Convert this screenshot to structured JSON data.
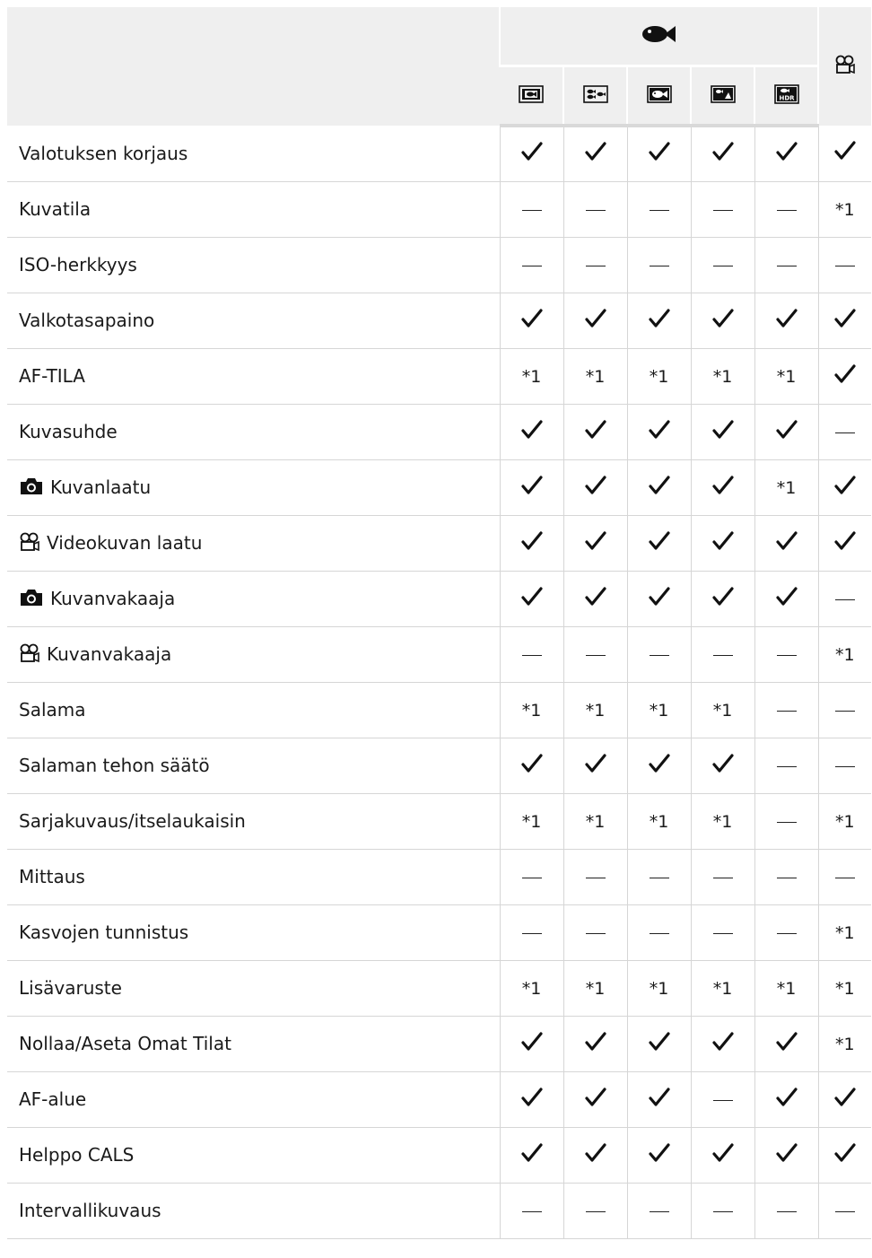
{
  "header": {
    "group_icon": "fish-icon",
    "movie_icon": "movie-camera-icon",
    "mode_icons": [
      "underwater-snapshot-icon",
      "underwater-wide-icon",
      "underwater-macro-icon",
      "underwater-microscope-icon",
      "underwater-hdr-icon"
    ],
    "hdr_text": "HDR"
  },
  "rows": [
    {
      "label": "Valotuksen korjaus",
      "icon": null,
      "values": [
        "check",
        "check",
        "check",
        "check",
        "check",
        "check"
      ]
    },
    {
      "label": "Kuvatila",
      "icon": null,
      "values": [
        "dash",
        "dash",
        "dash",
        "dash",
        "dash",
        "*1"
      ]
    },
    {
      "label": "ISO-herkkyys",
      "icon": null,
      "values": [
        "dash",
        "dash",
        "dash",
        "dash",
        "dash",
        "dash"
      ]
    },
    {
      "label": "Valkotasapaino",
      "icon": null,
      "values": [
        "check",
        "check",
        "check",
        "check",
        "check",
        "check"
      ]
    },
    {
      "label": "AF-TILA",
      "icon": null,
      "values": [
        "*1",
        "*1",
        "*1",
        "*1",
        "*1",
        "check"
      ]
    },
    {
      "label": "Kuvasuhde",
      "icon": null,
      "values": [
        "check",
        "check",
        "check",
        "check",
        "check",
        "dash"
      ]
    },
    {
      "label": "Kuvanlaatu",
      "icon": "still-camera-icon",
      "values": [
        "check",
        "check",
        "check",
        "check",
        "*1",
        "check"
      ]
    },
    {
      "label": "Videokuvan laatu",
      "icon": "movie-camera-icon",
      "values": [
        "check",
        "check",
        "check",
        "check",
        "check",
        "check"
      ]
    },
    {
      "label": "Kuvanvakaaja",
      "icon": "still-camera-icon",
      "values": [
        "check",
        "check",
        "check",
        "check",
        "check",
        "dash"
      ]
    },
    {
      "label": "Kuvanvakaaja",
      "icon": "movie-camera-icon",
      "values": [
        "dash",
        "dash",
        "dash",
        "dash",
        "dash",
        "*1"
      ]
    },
    {
      "label": "Salama",
      "icon": null,
      "values": [
        "*1",
        "*1",
        "*1",
        "*1",
        "dash",
        "dash"
      ]
    },
    {
      "label": "Salaman tehon säätö",
      "icon": null,
      "values": [
        "check",
        "check",
        "check",
        "check",
        "dash",
        "dash"
      ]
    },
    {
      "label": "Sarjakuvaus/itselaukaisin",
      "icon": null,
      "values": [
        "*1",
        "*1",
        "*1",
        "*1",
        "dash",
        "*1"
      ]
    },
    {
      "label": "Mittaus",
      "icon": null,
      "values": [
        "dash",
        "dash",
        "dash",
        "dash",
        "dash",
        "dash"
      ]
    },
    {
      "label": "Kasvojen tunnistus",
      "icon": null,
      "values": [
        "dash",
        "dash",
        "dash",
        "dash",
        "dash",
        "*1"
      ]
    },
    {
      "label": "Lisävaruste",
      "icon": null,
      "values": [
        "*1",
        "*1",
        "*1",
        "*1",
        "*1",
        "*1"
      ]
    },
    {
      "label": "Nollaa/Aseta Omat Tilat",
      "icon": null,
      "values": [
        "check",
        "check",
        "check",
        "check",
        "check",
        "*1"
      ]
    },
    {
      "label": "AF-alue",
      "icon": null,
      "values": [
        "check",
        "check",
        "check",
        "dash",
        "check",
        "check"
      ]
    },
    {
      "label": "Helppo CALS",
      "icon": null,
      "values": [
        "check",
        "check",
        "check",
        "check",
        "check",
        "check"
      ]
    },
    {
      "label": "Intervallikuvaus",
      "icon": null,
      "values": [
        "dash",
        "dash",
        "dash",
        "dash",
        "dash",
        "dash"
      ]
    }
  ]
}
